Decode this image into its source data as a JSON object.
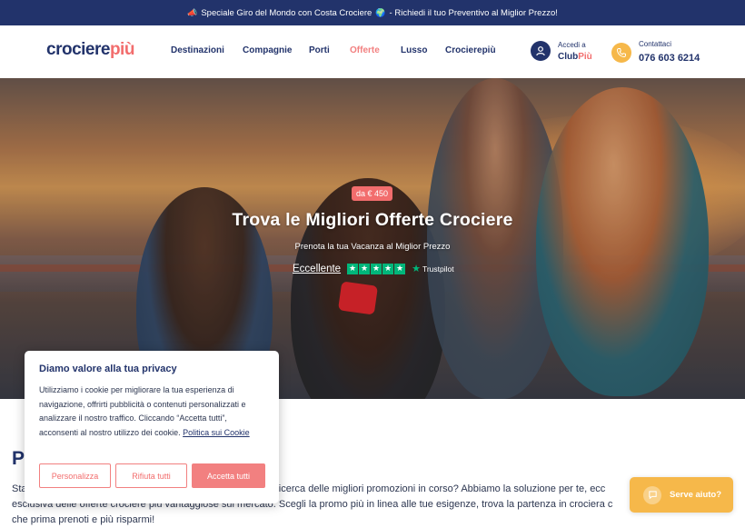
{
  "topbar": {
    "icon": "📣",
    "text_a": "Speciale Giro del Mondo con Costa Crociere",
    "globe": "🌍",
    "text_b": "- Richiedi il tuo Preventivo al Miglior Prezzo!"
  },
  "header": {
    "logo_a": "crociere",
    "logo_b": "più",
    "nav": [
      "Destinazioni",
      "Compagnie",
      "Porti",
      "Offerte",
      "Lusso",
      "Crocierepiù"
    ],
    "club": {
      "label": "Accedi a",
      "name_a": "Club",
      "name_b": "Più",
      "icon": "user-icon"
    },
    "contact": {
      "label": "Contattaci",
      "phone": "076 603 6214",
      "icon": "phone-icon"
    },
    "colors": {
      "navy": "#22336b",
      "coral": "#f26d6d",
      "amber": "#f6b84a"
    }
  },
  "hero": {
    "badge": "da € 450",
    "title": "Trova le Migliori Offerte Crociere",
    "subtitle": "Prenota la tua Vacanza al Miglior Prezzo",
    "rating_word": "Eccellente",
    "stars": 5,
    "trustpilot": "Trustpilot"
  },
  "main": {
    "title_initial": "P",
    "lines": [
      "Sta",
      "esclusiva delle offerte crociere più vantaggiose sul mercato. Scegli la promo più in linea alle tue esigenze, trova la partenza in crociera c",
      "che prima prenoti e più risparmi!"
    ],
    "line1_tail": "la ricerca delle migliori promozioni in corso? Abbiamo la soluzione per te, ecc"
  },
  "cookie": {
    "title": "Diamo valore alla tua privacy",
    "body": "Utilizziamo i cookie per migliorare la tua esperienza di navigazione, offrirti pubblicità o contenuti personalizzati e analizzare il nostro traffico. Cliccando “Accetta tutti”, acconsenti al nostro utilizzo dei cookie.",
    "link": "Politica sui Cookie",
    "buttons": {
      "customize": "Personalizza",
      "reject": "Rifiuta tutti",
      "accept": "Accetta tutti"
    }
  },
  "help": {
    "label": "Serve aiuto?",
    "icon": "chat-icon"
  }
}
